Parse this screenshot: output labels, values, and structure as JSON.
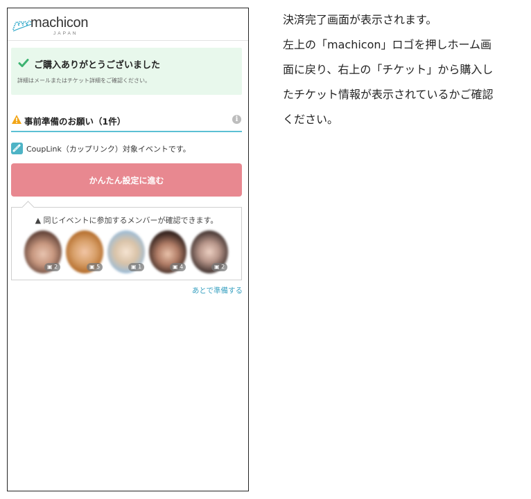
{
  "app": {
    "logo_text": "machicon",
    "logo_sub": "JAPAN"
  },
  "success": {
    "title": "ご購入ありがとうございました",
    "subtitle": "詳細はメールまたはチケット詳細をご確認ください。"
  },
  "prep": {
    "title": "事前準備のお願い（1件）"
  },
  "couplink": {
    "text": "CoupLink（カップリンク）対象イベントです。"
  },
  "setup_button": {
    "label": "かんたん設定に進む"
  },
  "members": {
    "title": "▲ 同じイベントに参加するメンバーが確認できます。",
    "avatars": [
      {
        "photo_count": "2"
      },
      {
        "photo_count": "5"
      },
      {
        "photo_count": "1"
      },
      {
        "photo_count": "4"
      },
      {
        "photo_count": "2"
      }
    ]
  },
  "later_link": "あとで準備する",
  "instructions": [
    "決済完了画面が表示されます。",
    "左上の「machicon」ロゴを押しホーム画",
    "面に戻り、右上の「チケット」から購入し",
    "たチケット情報が表示されているかご確認",
    "ください。"
  ],
  "colors": {
    "success_bg": "#e8f8ec",
    "check_green": "#3cb371",
    "accent_teal": "#5bc0d4",
    "button_pink": "#e88890",
    "warning_orange": "#f2a516",
    "link_blue": "#3aa1c1"
  },
  "icons": [
    "machicon-logo-icon",
    "check-icon",
    "warning-icon",
    "info-icon",
    "couplink-icon",
    "camera-icon"
  ]
}
